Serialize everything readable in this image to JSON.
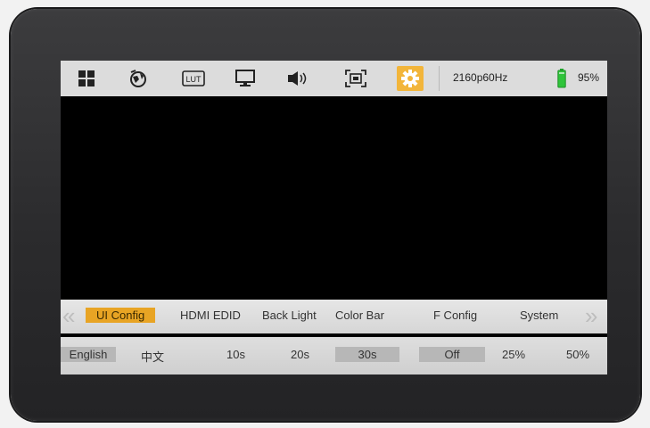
{
  "status_bar": {
    "icons": [
      "grid-icon",
      "globe-icon",
      "lut-icon",
      "monitor-icon",
      "speaker-icon",
      "screen-frame-icon",
      "settings-gear-icon"
    ],
    "signal": "2160p60Hz",
    "battery": "95%"
  },
  "menu": {
    "items": [
      "UI Config",
      "HDMI EDID",
      "Back Light",
      "Color Bar",
      "F Config",
      "System"
    ],
    "selected": "UI Config"
  },
  "options": {
    "items": [
      "English",
      "中文",
      "10s",
      "20s",
      "30s",
      "Off",
      "25%",
      "50%"
    ],
    "selected": [
      "English",
      "30s",
      "Off"
    ]
  },
  "colors": {
    "accent": "#f2b53a",
    "selected_menu": "#e8a424",
    "bezel": "#2f2f31"
  }
}
